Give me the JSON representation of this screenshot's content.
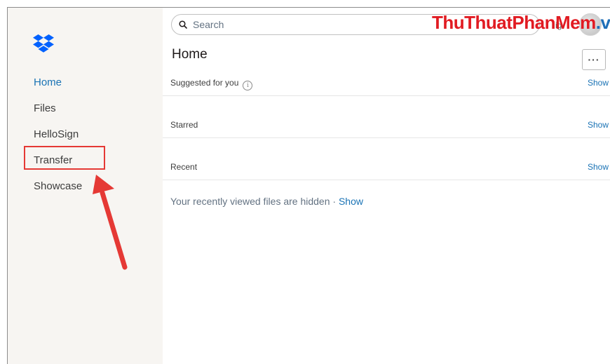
{
  "search": {
    "placeholder": "Search"
  },
  "watermark": {
    "part1": "ThuThuat",
    "part2": "PhanMem",
    "part3": ".vn"
  },
  "avatar_fragment": "ig",
  "sidebar": {
    "items": [
      {
        "label": "Home"
      },
      {
        "label": "Files"
      },
      {
        "label": "HelloSign"
      },
      {
        "label": "Transfer"
      },
      {
        "label": "Showcase"
      }
    ]
  },
  "main": {
    "title": "Home",
    "more_label": "···",
    "sections": [
      {
        "label": "Suggested for you",
        "action": "Show"
      },
      {
        "label": "Starred",
        "action": "Show"
      },
      {
        "label": "Recent",
        "action": "Show"
      }
    ],
    "recent_hidden_text": "Your recently viewed files are hidden",
    "separator": " · ",
    "recent_show": "Show"
  },
  "colors": {
    "accent": "#1a73b5",
    "sidebar_bg": "#f7f5f2",
    "highlight": "#e53935"
  },
  "icons": {
    "logo": "dropbox-logo-icon",
    "search": "search-icon",
    "info": "info-icon",
    "annotation": "red-arrow"
  }
}
